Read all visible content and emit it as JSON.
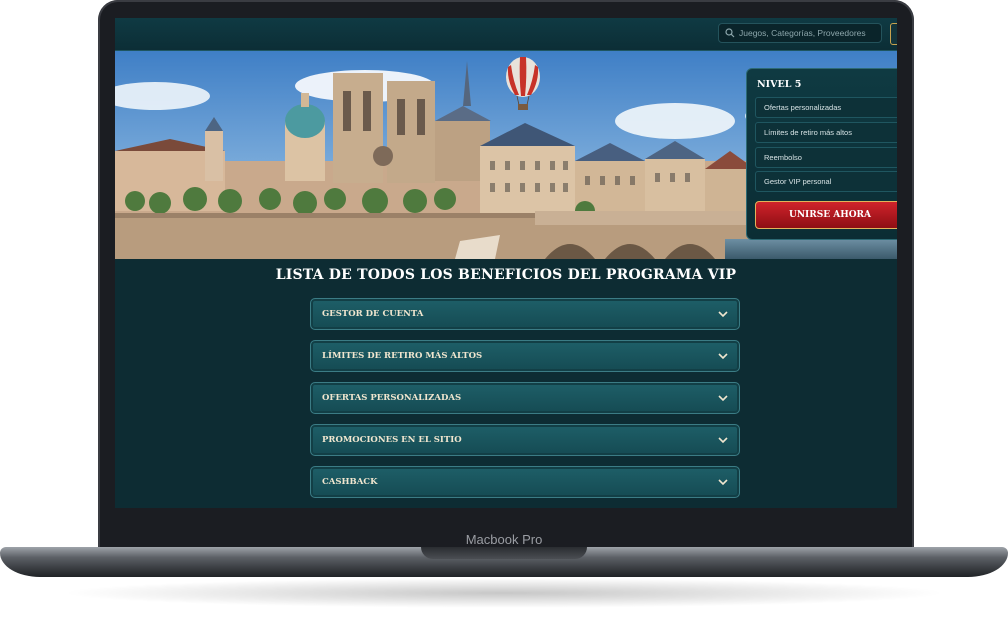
{
  "device": {
    "model_label": "Macbook Pro"
  },
  "topbar": {
    "search_placeholder": "Juegos, Categorías, Proveedores"
  },
  "vip_panel": {
    "level_title": "NIVEL 5",
    "items": [
      "Ofertas personalizadas",
      "Límites de retiro más altos",
      "Reembolso",
      "Gestor VIP personal"
    ],
    "join_button": "UNIRSE AHORA"
  },
  "benefits": {
    "title": "LISTA DE TODOS LOS BENEFICIOS DEL PROGRAMA VIP",
    "items": [
      {
        "label": "GESTOR DE CUENTA"
      },
      {
        "label": "LÍMITES DE RETIRO MÁS ALTOS"
      },
      {
        "label": "OFERTAS PERSONALIZADAS"
      },
      {
        "label": "PROMOCIONES EN EL SITIO"
      },
      {
        "label": "CASHBACK"
      }
    ]
  },
  "colors": {
    "accent_gold": "#c8a24e",
    "join_red": "#c41e25",
    "panel_teal": "#0f3a42"
  }
}
